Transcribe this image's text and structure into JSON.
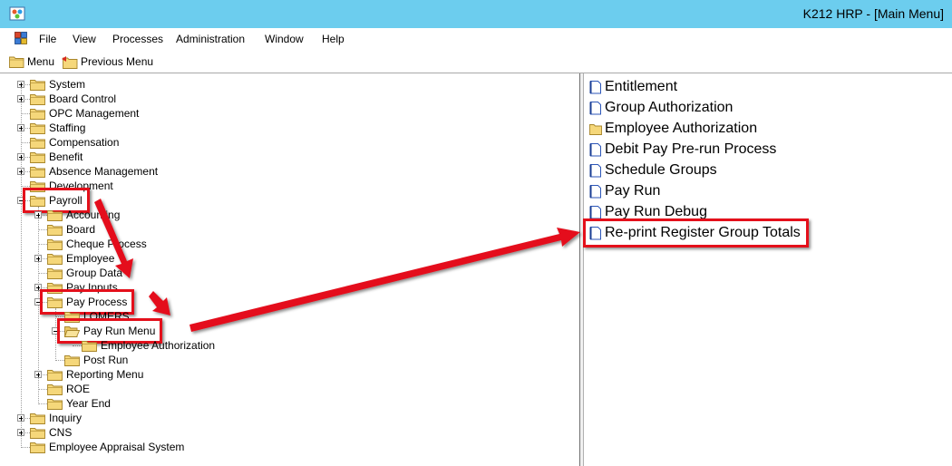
{
  "window": {
    "title": "K212 HRP - [Main Menu]"
  },
  "menubar": [
    "File",
    "View",
    "Processes",
    "Administration",
    "Window",
    "Help"
  ],
  "toolbar": {
    "menu_label": "Menu",
    "previous_label": "Previous Menu"
  },
  "tree": [
    {
      "label": "System",
      "level": 0,
      "expander": "plus"
    },
    {
      "label": "Board Control",
      "level": 0,
      "expander": "plus"
    },
    {
      "label": "OPC Management",
      "level": 0,
      "expander": "none"
    },
    {
      "label": "Staffing",
      "level": 0,
      "expander": "plus"
    },
    {
      "label": "Compensation",
      "level": 0,
      "expander": "none"
    },
    {
      "label": "Benefit",
      "level": 0,
      "expander": "plus"
    },
    {
      "label": "Absence Management",
      "level": 0,
      "expander": "plus"
    },
    {
      "label": "Development",
      "level": 0,
      "expander": "none"
    },
    {
      "label": "Payroll",
      "level": 0,
      "expander": "minus",
      "highlighted": true
    },
    {
      "label": "Accounting",
      "level": 1,
      "expander": "plus"
    },
    {
      "label": "Board",
      "level": 1,
      "expander": "none"
    },
    {
      "label": "Cheque Process",
      "level": 1,
      "expander": "none"
    },
    {
      "label": "Employee",
      "level": 1,
      "expander": "plus"
    },
    {
      "label": "Group Data",
      "level": 1,
      "expander": "none"
    },
    {
      "label": "Pay Inputs",
      "level": 1,
      "expander": "plus"
    },
    {
      "label": "Pay Process",
      "level": 1,
      "expander": "minus",
      "highlighted": true
    },
    {
      "label": "LOMERS",
      "level": 2,
      "expander": "none"
    },
    {
      "label": "Pay Run Menu",
      "level": 2,
      "expander": "minus",
      "highlighted": true,
      "open": true
    },
    {
      "label": "Employee Authorization",
      "level": 3,
      "expander": "none"
    },
    {
      "label": "Post Run",
      "level": 2,
      "expander": "none"
    },
    {
      "label": "Reporting Menu",
      "level": 1,
      "expander": "plus"
    },
    {
      "label": "ROE",
      "level": 1,
      "expander": "none"
    },
    {
      "label": "Year End",
      "level": 1,
      "expander": "none"
    },
    {
      "label": "Inquiry",
      "level": 0,
      "expander": "plus"
    },
    {
      "label": "CNS",
      "level": 0,
      "expander": "plus"
    },
    {
      "label": "Employee Appraisal System",
      "level": 0,
      "expander": "none"
    }
  ],
  "right_list": [
    {
      "label": "Entitlement",
      "icon": "document-icon"
    },
    {
      "label": "Group Authorization",
      "icon": "document-icon"
    },
    {
      "label": "Employee Authorization",
      "icon": "folder-icon"
    },
    {
      "label": "Debit Pay Pre-run Process",
      "icon": "document-icon"
    },
    {
      "label": "Schedule Groups",
      "icon": "document-icon"
    },
    {
      "label": "Pay Run",
      "icon": "document-icon"
    },
    {
      "label": "Pay Run Debug",
      "icon": "document-icon"
    },
    {
      "label": "Re-print Register Group Totals",
      "icon": "document-icon",
      "highlighted": true
    }
  ],
  "colors": {
    "titlebar": "#6ccdee",
    "highlight": "#e4101b",
    "folder": "#f5d77a"
  }
}
